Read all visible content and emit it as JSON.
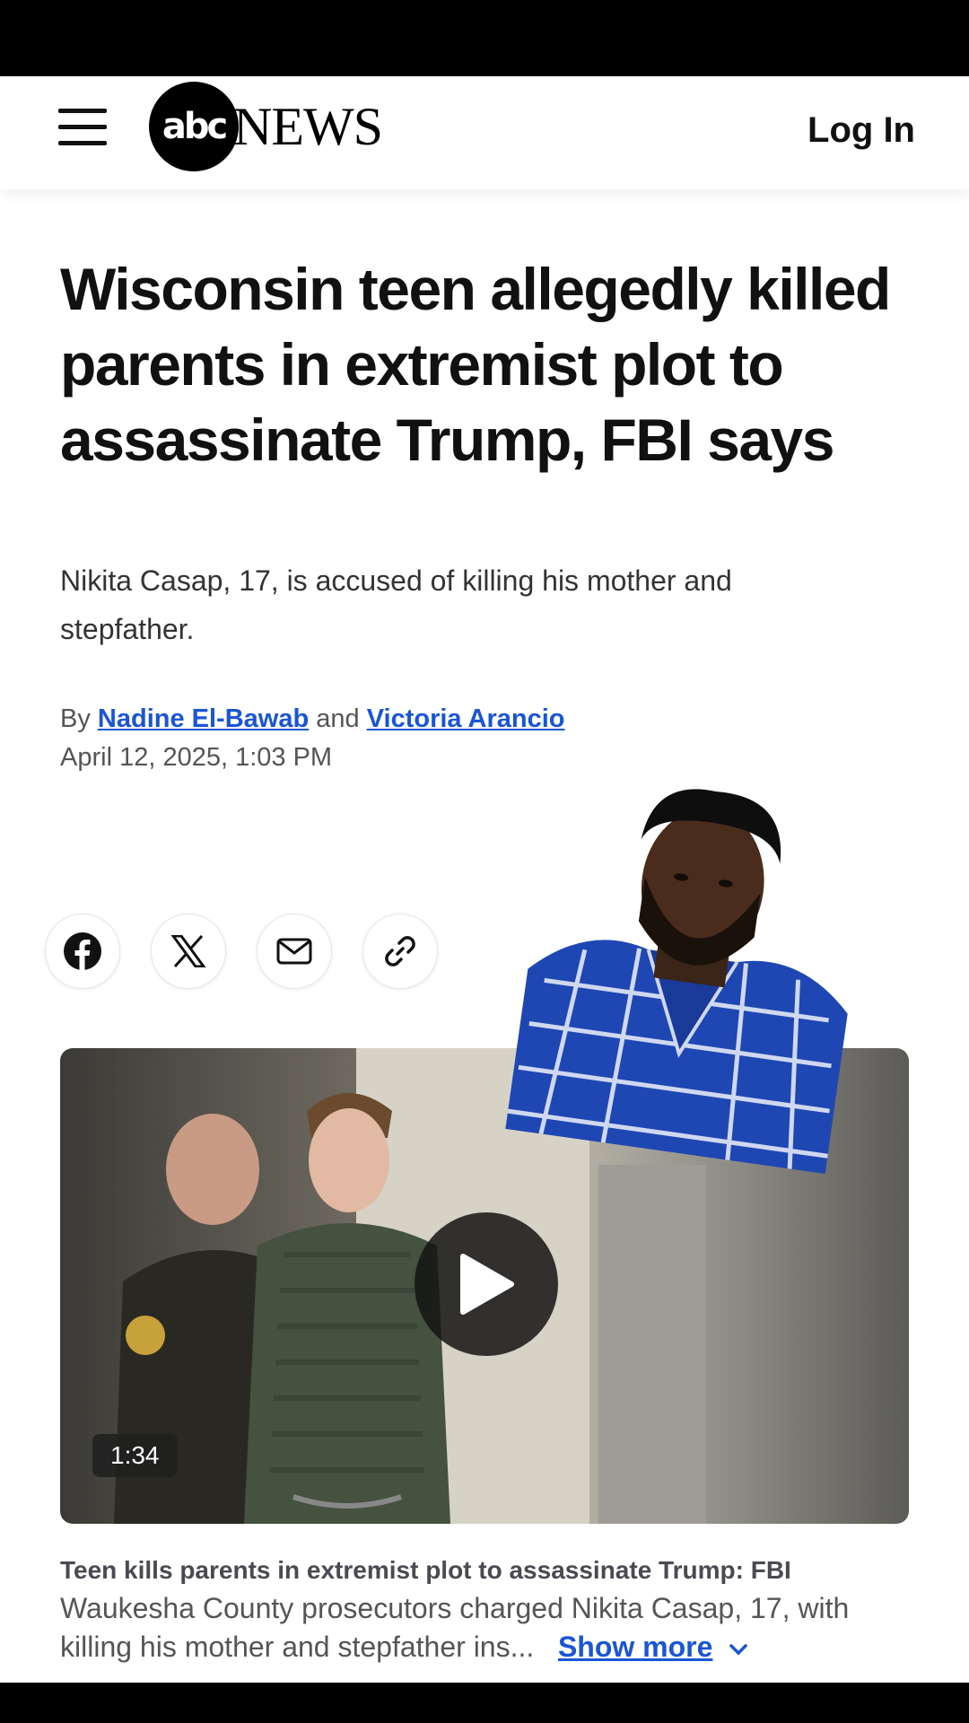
{
  "header": {
    "logo_badge": "abc",
    "logo_text": "NEWS",
    "login_label": "Log In"
  },
  "article": {
    "headline": "Wisconsin teen allegedly killed parents in extremist plot to assassinate Trump, FBI says",
    "dek": "Nikita Casap, 17, is accused of killing his mother and stepfather.",
    "byline_prefix": "By",
    "author_1": "Nadine El-Bawab",
    "byline_joiner": "and",
    "author_2": "Victoria Arancio",
    "date": "April 12, 2025, 1:03 PM"
  },
  "share": {
    "icons": [
      "facebook-icon",
      "x-icon",
      "email-icon",
      "link-icon"
    ]
  },
  "video": {
    "duration": "1:34",
    "caption_title": "Teen kills parents in extremist plot to assassinate Trump: FBI",
    "caption_text": "Waukesha County prosecutors charged Nikita Casap, 17, with killing his mother and stepfather ins...",
    "show_more_label": "Show more"
  },
  "colors": {
    "link": "#1a55d4",
    "text": "#111111"
  }
}
